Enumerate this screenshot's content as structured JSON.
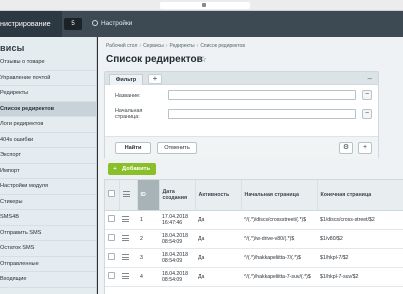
{
  "browser": {
    "url": ""
  },
  "topbar": {
    "brand": "нистрирование",
    "notifications": "5",
    "settings": "Настройки"
  },
  "sidebar": {
    "heading": "висы",
    "items": [
      "Отзывы о товаре",
      "Управление почтой",
      "Редиректы",
      "Список редиректов",
      "Логи редиректов",
      "404s ошибки",
      "Экспорт",
      "Импорт",
      "Настройки модуля",
      "Стикеры",
      "SMS4B",
      "Отправить SMS",
      "Остаток SMS",
      "Отправленные",
      "Входящие"
    ],
    "active_index": 3
  },
  "breadcrumbs": [
    "Рабочий стол",
    "Сервисы",
    "Редиректы",
    "Список редиректов"
  ],
  "page_title": "Список редиректов",
  "filter": {
    "tab": "Фильтр",
    "add": "+",
    "collapse": "‒",
    "fields": [
      {
        "label": "Название:",
        "value": ""
      },
      {
        "label": "Начальная страница:",
        "value": ""
      }
    ],
    "find": "Найти",
    "cancel": "Отменить"
  },
  "add_button": "Добавить",
  "table": {
    "columns": [
      "ID",
      "Дата создания",
      "Активность",
      "Начальная страница",
      "Конечная страница"
    ],
    "rows": [
      {
        "id": "1",
        "date": "17.04.2018",
        "time": "16:47:46",
        "active": "Да",
        "from": "^/(.*)/discs/crossstreet/(.*)$",
        "to": "$1/discs/cross-street/$2"
      },
      {
        "id": "2",
        "date": "18.04.2018",
        "time": "08:54:09",
        "active": "Да",
        "from": "^/(.*)/w-drive-v80/(.*)$",
        "to": "$1/v80/$2"
      },
      {
        "id": "3",
        "date": "18.04.2018",
        "time": "08:54:09",
        "active": "Да",
        "from": "^/(.*)/hakkapeliitta-7/(.*)$",
        "to": "$1/hkpl-7/$2"
      },
      {
        "id": "4",
        "date": "18.04.2018",
        "time": "08:54:09",
        "active": "Да",
        "from": "^/(.*)/hakkapeliitta-7-suv/(.*)$",
        "to": "$1/hkpl-7-suv/$2"
      }
    ]
  }
}
